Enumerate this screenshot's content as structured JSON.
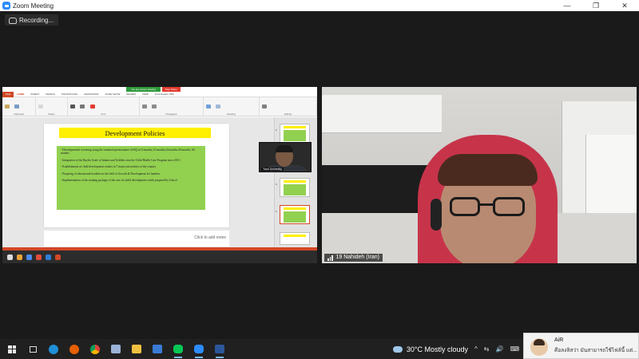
{
  "window": {
    "title": "Zoom Meeting",
    "controls": [
      "—",
      "❐",
      "✕"
    ]
  },
  "recording": {
    "label": "Recording..."
  },
  "ppt": {
    "share_status": "You are screen sharing",
    "stop_share": "Stop Share",
    "tabs": [
      "FILE",
      "HOME",
      "INSERT",
      "DESIGN",
      "TRANSITIONS",
      "ANIMATIONS",
      "SLIDE SHOW",
      "REVIEW",
      "VIEW",
      "Foxit Reader PDF"
    ],
    "active_tab": "HOME",
    "ribbon_groups": [
      "Clipboard",
      "Slides",
      "Font",
      "Paragraph",
      "Drawing",
      "Editing"
    ],
    "slide": {
      "title": "Development Policies",
      "bullets": [
        "- Developmental screening using the standard questionnaire (ASQ) at 6 months,12 months,24 months,36 months, 60 months",
        "- Integration of the Bayley Scale of Infants and Toddlers into the Child Health Care Program since 2013",
        "- Establishment of child development centers in 7 major universities of the country",
        "- Preparing of educational booklets in the field of Growth & Development for families",
        "- Implementation of the training package of the care for child development which prepared by Unicef"
      ]
    },
    "notes_placeholder": "Click to add notes",
    "thumb_numbers": [
      "6",
      "7",
      "8",
      "9"
    ],
    "pip_name": "Yazd University"
  },
  "video": {
    "participant_name": "19 Nahideh (Iran)"
  },
  "taskbar": {
    "weather": "30°C  Mostly cloudy",
    "tray_symbols": [
      "^",
      "⇆",
      "🔊",
      "⌨"
    ]
  },
  "toast": {
    "sender": "AiR",
    "message": "คือลงลิสว่า มันสามารถใช้ไฟล์นี้ แต่..."
  },
  "colors": {
    "zoom_blue": "#2d8cff",
    "ppt_orange": "#d24726",
    "slide_yellow": "#ffef00",
    "slide_green": "#92d050",
    "share_green": "#2e9a3a",
    "stop_red": "#e23b2e"
  }
}
